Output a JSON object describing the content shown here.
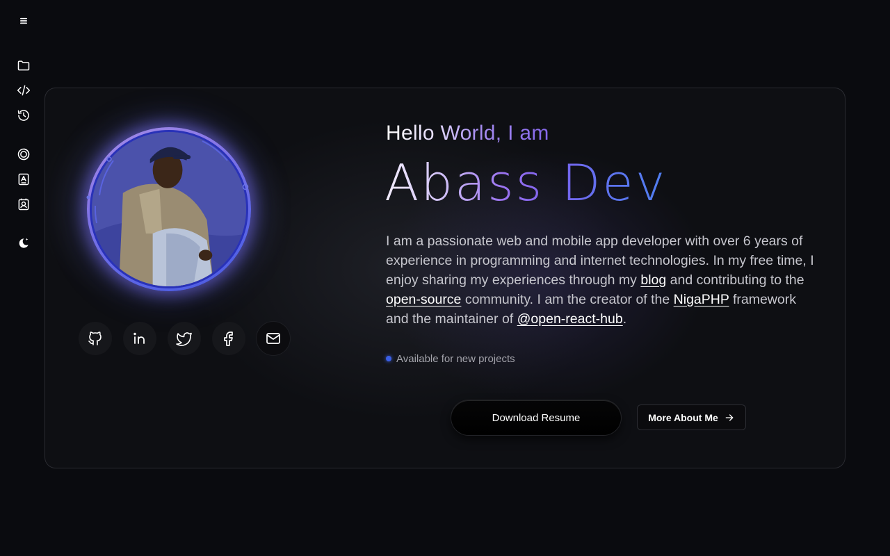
{
  "sidebar": {
    "items": [
      {
        "icon": "menu-icon"
      },
      {
        "icon": "folder-icon"
      },
      {
        "icon": "code-icon"
      },
      {
        "icon": "history-icon"
      },
      {
        "icon": "blog-icon"
      },
      {
        "icon": "resume-icon"
      },
      {
        "icon": "contact-icon"
      },
      {
        "icon": "moon-icon"
      }
    ]
  },
  "hero": {
    "greeting": "Hello World, I am",
    "name": "Abass Dev",
    "bio": {
      "p1": "I am a passionate web and mobile app developer with over 6 years of experience in programming and internet technologies. In my free time, I enjoy sharing my experiences through my ",
      "link_blog": "blog",
      "p2": " and contributing to the ",
      "link_oss": "open-source",
      "p3": " community. I am the creator of the ",
      "link_niga": "NigaPHP",
      "p4": " framework and the maintainer of ",
      "link_hub": "@open-react-hub",
      "p5": "."
    },
    "status": "Available for new projects",
    "download_label": "Download Resume",
    "more_label": "More About Me"
  },
  "socials": [
    {
      "icon": "github-icon"
    },
    {
      "icon": "linkedin-icon"
    },
    {
      "icon": "twitter-icon"
    },
    {
      "icon": "facebook-icon"
    },
    {
      "icon": "mail-icon"
    }
  ],
  "colors": {
    "background": "#0a0b0f",
    "accent_purple": "#8466ea",
    "accent_blue": "#4f7ff0",
    "status_dot": "#3a5fe6"
  }
}
